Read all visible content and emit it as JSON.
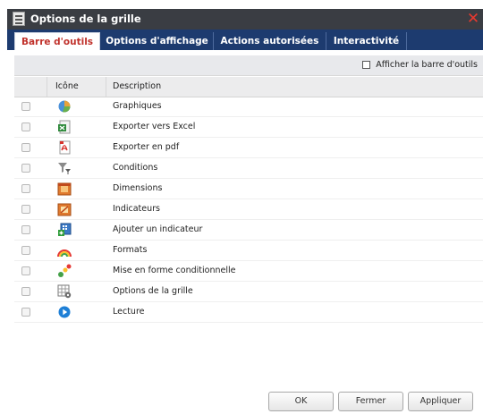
{
  "window": {
    "title": "Options de la grille",
    "close_icon": "close-icon"
  },
  "tabs": [
    {
      "label": "Barre d'outils",
      "active": true
    },
    {
      "label": "Options d'affichage",
      "active": false
    },
    {
      "label": "Actions autorisées",
      "active": false
    },
    {
      "label": "Interactivité",
      "active": false
    }
  ],
  "toolbar_toggle": {
    "label": "Afficher la barre d'outils",
    "checked": false
  },
  "table": {
    "headers": {
      "icon": "Icône",
      "description": "Description"
    },
    "rows": [
      {
        "icon": "chart-pie-icon",
        "description": "Graphiques",
        "checked": false
      },
      {
        "icon": "excel-export-icon",
        "description": "Exporter vers Excel",
        "checked": false
      },
      {
        "icon": "pdf-export-icon",
        "description": "Exporter en pdf",
        "checked": false
      },
      {
        "icon": "filter-conditions-icon",
        "description": "Conditions",
        "checked": false
      },
      {
        "icon": "dimensions-icon",
        "description": "Dimensions",
        "checked": false
      },
      {
        "icon": "indicators-icon",
        "description": "Indicateurs",
        "checked": false
      },
      {
        "icon": "add-indicator-icon",
        "description": "Ajouter un indicateur",
        "checked": false
      },
      {
        "icon": "formats-rainbow-icon",
        "description": "Formats",
        "checked": false
      },
      {
        "icon": "conditional-format-icon",
        "description": "Mise en forme conditionnelle",
        "checked": false
      },
      {
        "icon": "grid-options-icon",
        "description": "Options de la grille",
        "checked": false
      },
      {
        "icon": "play-icon",
        "description": "Lecture",
        "checked": false
      }
    ]
  },
  "buttons": {
    "ok": "OK",
    "close": "Fermer",
    "apply": "Appliquer"
  },
  "colors": {
    "titlebar": "#3a3d43",
    "tabbar": "#1d3b6f",
    "active_tab_text": "#c0312b",
    "close_x": "#e8392f"
  }
}
